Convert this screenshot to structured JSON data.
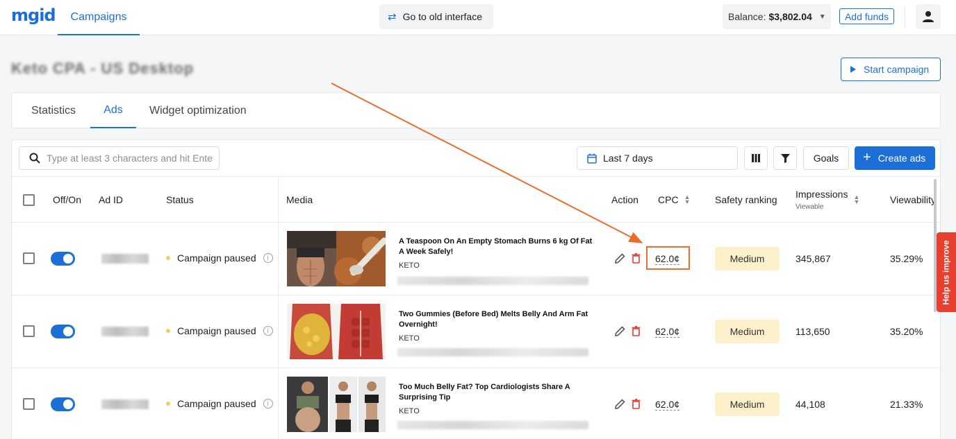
{
  "header": {
    "logo": "mgid",
    "nav_campaigns": "Campaigns",
    "old_interface": "Go to old interface",
    "balance_label": "Balance:",
    "balance_value": "$3,802.04",
    "add_funds": "Add funds"
  },
  "page": {
    "title": "Keto CPA - US Desktop",
    "start_campaign": "Start campaign"
  },
  "tabs": [
    {
      "label": "Statistics",
      "active": false
    },
    {
      "label": "Ads",
      "active": true
    },
    {
      "label": "Widget optimization",
      "active": false
    }
  ],
  "toolbar": {
    "search_placeholder": "Type at least 3 characters and hit Enter",
    "date_range": "Last 7 days",
    "goals": "Goals",
    "create_ads": "Create ads"
  },
  "table": {
    "columns": {
      "off_on": "Off/On",
      "ad_id": "Ad ID",
      "status": "Status",
      "media": "Media",
      "action": "Action",
      "cpc": "CPC",
      "safety": "Safety ranking",
      "impressions": "Impressions",
      "impressions_sub": "Viewable",
      "viewability": "Viewability"
    },
    "rows": [
      {
        "enabled": true,
        "status": "Campaign paused",
        "title": "A Teaspoon On An Empty Stomach Burns 6 kg Of Fat A Week Safely!",
        "category": "KETO",
        "cpc": "62.0¢",
        "safety": "Medium",
        "impressions": "345,867",
        "viewability": "35.29%"
      },
      {
        "enabled": true,
        "status": "Campaign paused",
        "title": "Two Gummies (Before Bed) Melts Belly And Arm Fat Overnight!",
        "category": "KETO",
        "cpc": "62.0¢",
        "safety": "Medium",
        "impressions": "113,650",
        "viewability": "35.20%"
      },
      {
        "enabled": true,
        "status": "Campaign paused",
        "title": "Too Much Belly Fat? Top Cardiologists Share A Surprising Tip",
        "category": "KETO",
        "cpc": "62.0¢",
        "safety": "Medium",
        "impressions": "44,108",
        "viewability": "21.33%"
      }
    ]
  },
  "help_tab": "Help us improve",
  "colors": {
    "accent": "#1d6fd8",
    "annotation": "#ea6d2a",
    "safety_bg": "#fdf1cc",
    "help_tab": "#e8402f"
  }
}
